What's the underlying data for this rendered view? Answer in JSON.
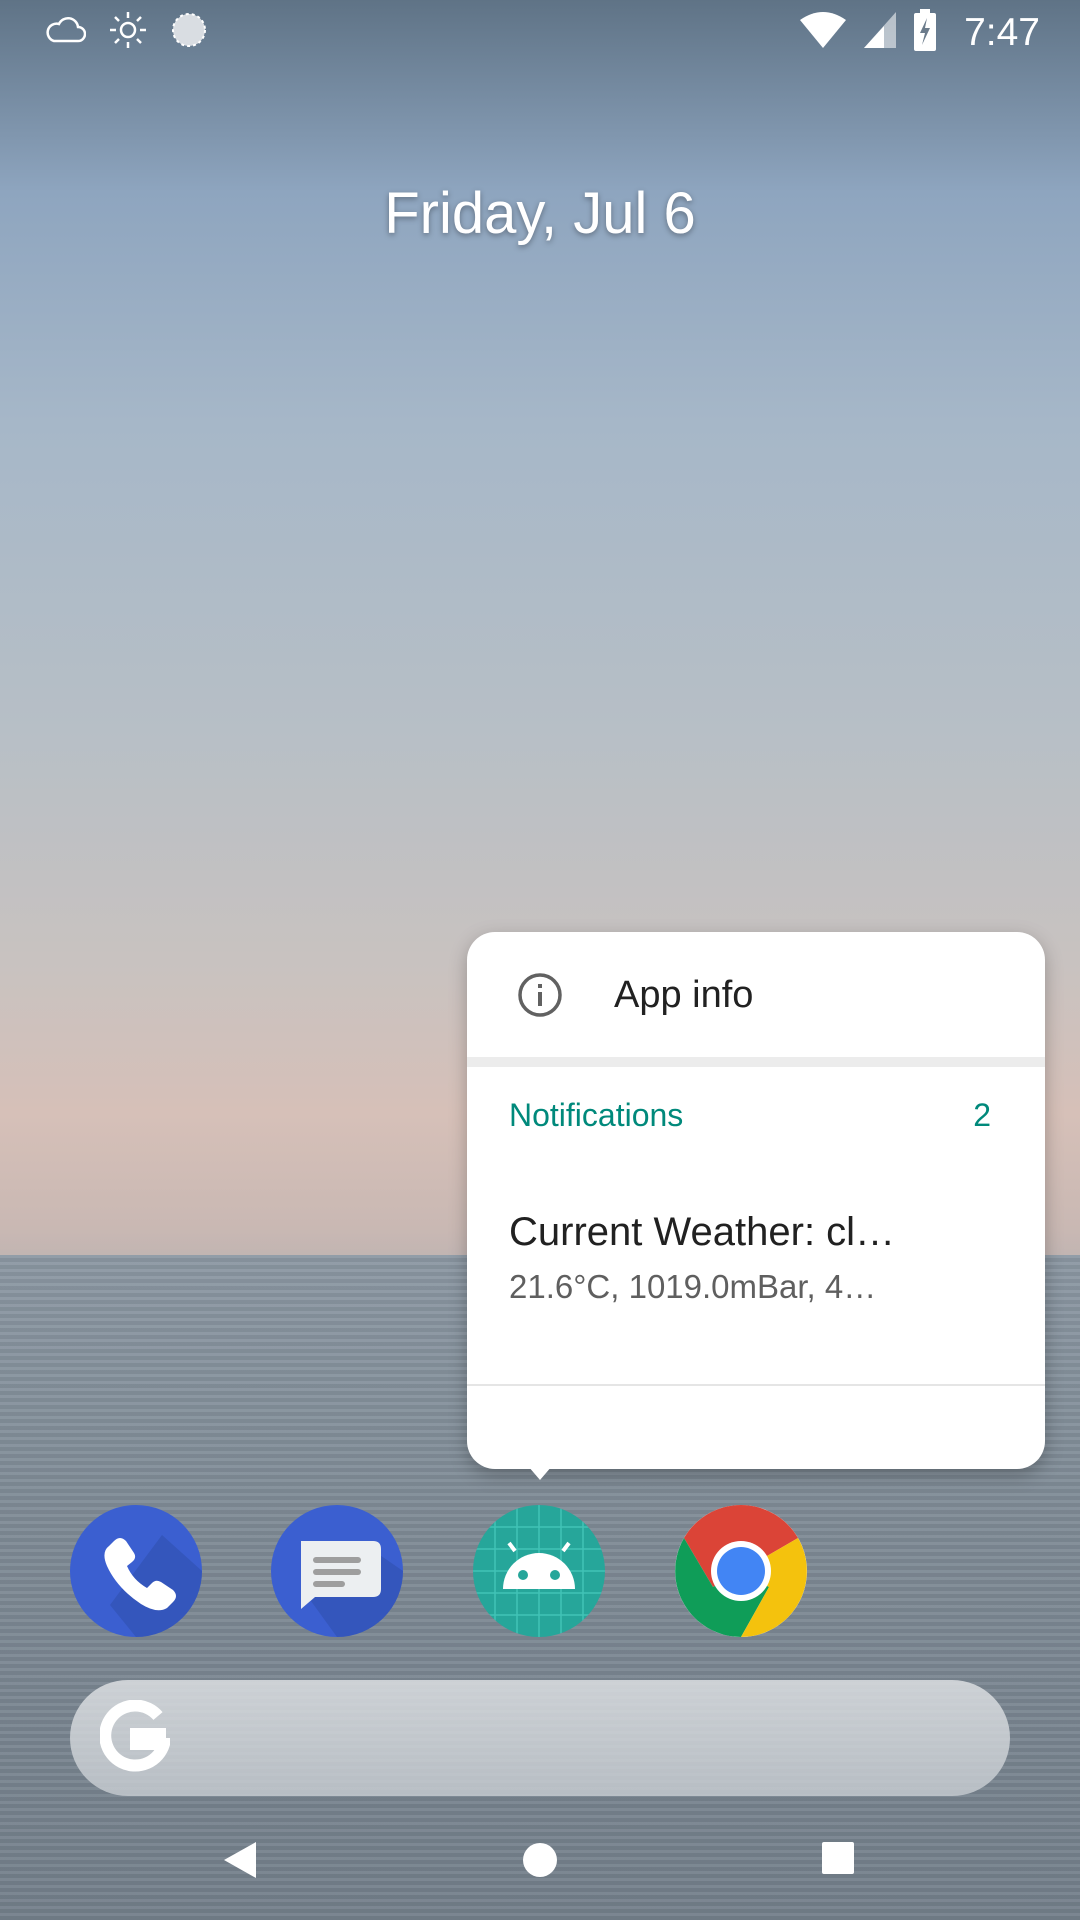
{
  "status_bar": {
    "time": "7:47",
    "left_icons": [
      "cloud-icon",
      "brightness-icon",
      "sync-icon"
    ],
    "right_icons": [
      "wifi-icon",
      "cell-signal-icon",
      "battery-charging-icon"
    ]
  },
  "home": {
    "date": "Friday, Jul 6"
  },
  "popup": {
    "app_info_label": "App info",
    "notifications_label": "Notifications",
    "notifications_count": "2",
    "notification": {
      "title": "Current Weather: cl…",
      "text": "21.6°C, 1019.0mBar, 4…"
    }
  },
  "dock": {
    "apps": [
      "phone-app-icon",
      "messages-app-icon",
      "android-app-icon",
      "chrome-app-icon"
    ]
  },
  "colors": {
    "accent": "#00897b",
    "phone": "#3b5fd0",
    "messages": "#3b5fd0",
    "android_app": "#26a69a"
  }
}
